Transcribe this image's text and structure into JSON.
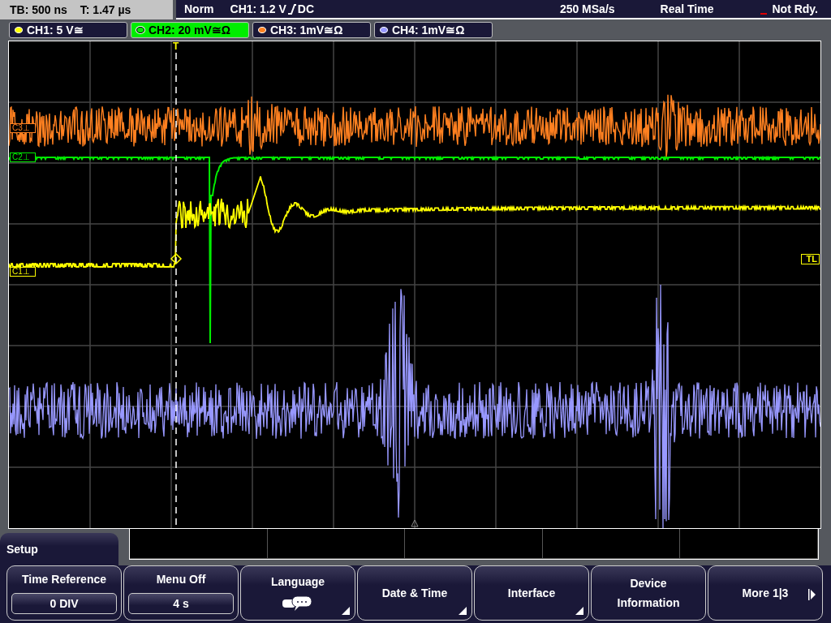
{
  "header": {
    "timebase": "TB: 500 ns",
    "trigger_time": "T: 1.47 µs",
    "trigger_mode": "Norm",
    "trigger_source": "CH1: 1.2 V",
    "coupling": "DC",
    "sample_rate": "250 MSa/s",
    "acquisition": "Real Time",
    "status": "Not Rdy."
  },
  "channels": [
    {
      "label": "CH1: 5 V≅",
      "color": "#ffff00",
      "selected": false
    },
    {
      "label": "CH2: 20 mV≅Ω",
      "color": "#00ee00",
      "selected": true
    },
    {
      "label": "CH3: 1mV≅Ω",
      "color": "#ff8020",
      "selected": false
    },
    {
      "label": "CH4: 1mV≅Ω",
      "color": "#9898ff",
      "selected": false
    }
  ],
  "markers": {
    "channel_labels": [
      "C3⊥",
      "C2⊥",
      "C1⊥"
    ],
    "trigger_level": "TL",
    "trigger_position": "T"
  },
  "menu": {
    "title": "Setup",
    "softkeys": [
      {
        "kind": "value",
        "label": "Time Reference",
        "value": "0 DIV",
        "submenu": false
      },
      {
        "kind": "value",
        "label": "Menu Off",
        "value": "4 s",
        "submenu": false
      },
      {
        "kind": "icon",
        "label": "Language",
        "submenu": true
      },
      {
        "kind": "plain",
        "label": "Date & Time",
        "submenu": true
      },
      {
        "kind": "plain",
        "label": "Interface",
        "submenu": true
      },
      {
        "kind": "plain",
        "label": "Device Information",
        "submenu": false
      },
      {
        "kind": "next",
        "label": "More 1|3",
        "submenu": false
      }
    ]
  }
}
